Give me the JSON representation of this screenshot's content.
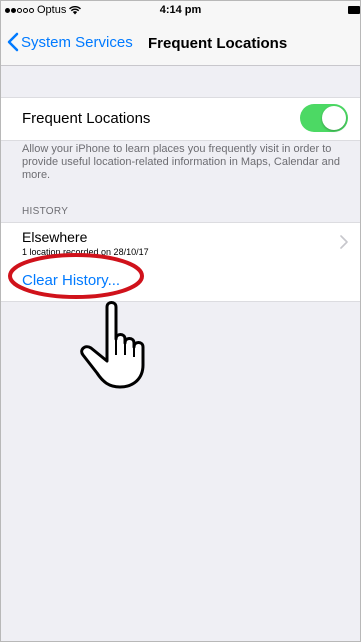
{
  "status_bar": {
    "carrier": "Optus",
    "time": "4:14 pm",
    "signal_bars_filled": 2,
    "signal_bars_total": 5
  },
  "nav": {
    "back_label": "System Services",
    "title": "Frequent Locations"
  },
  "toggle_row": {
    "label": "Frequent Locations",
    "enabled": true
  },
  "description": "Allow your iPhone to learn places you frequently visit in order to provide useful location-related information in Maps, Calendar and more.",
  "history": {
    "header": "HISTORY",
    "items": [
      {
        "title": "Elsewhere",
        "subtitle": "1 location recorded on 28/10/17"
      }
    ]
  },
  "clear_history_label": "Clear History...",
  "colors": {
    "ios_blue": "#007aff",
    "toggle_green": "#4cd964",
    "highlight_red": "#d0121b",
    "background": "#efeff4"
  },
  "icons": {
    "back": "chevron-left-icon",
    "disclosure": "chevron-right-icon",
    "annotation_pointer": "pointing-hand-icon",
    "annotation_highlight": "red-oval-highlight"
  }
}
